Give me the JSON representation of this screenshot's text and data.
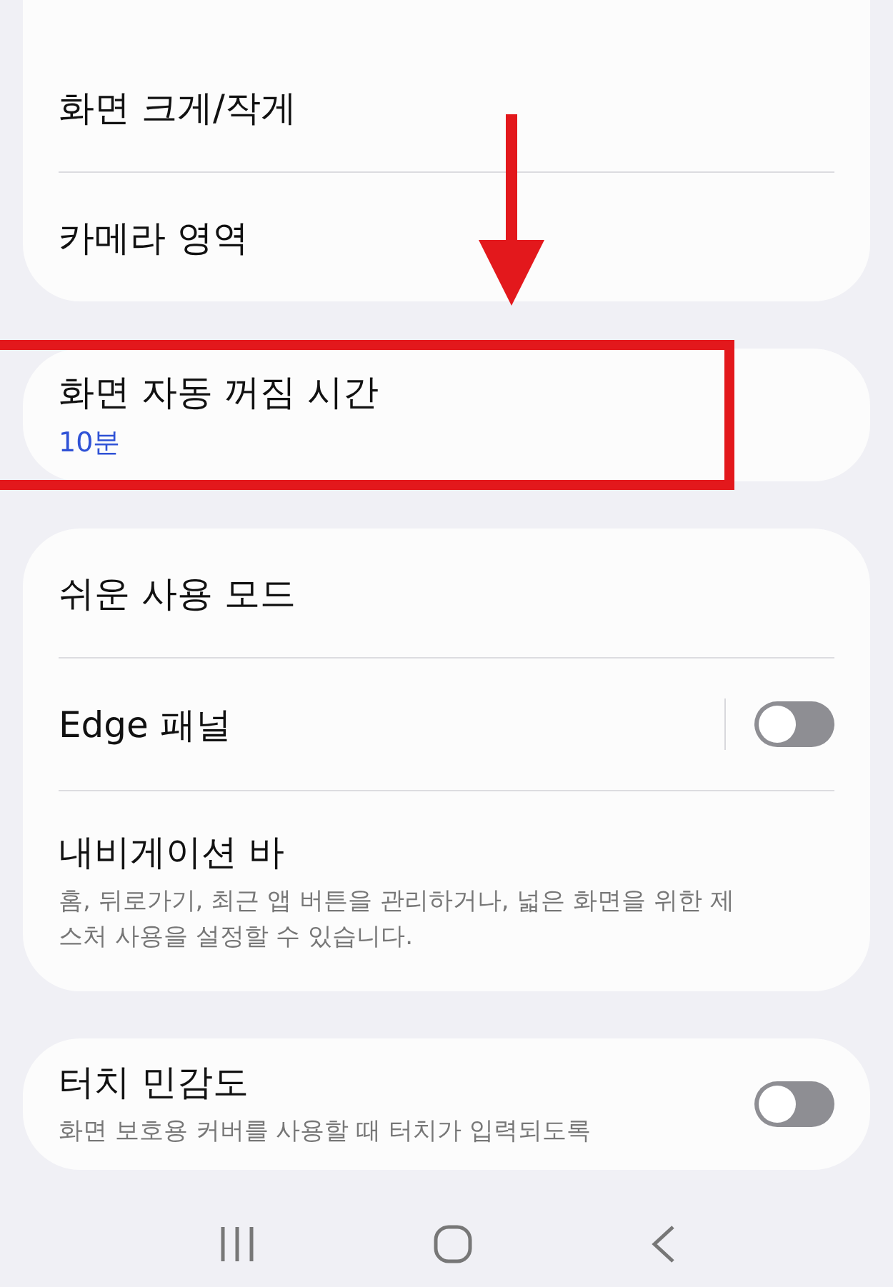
{
  "sections": [
    {
      "cut_top": true,
      "items": [
        {
          "kind": "plain",
          "title": "화면 크게/작게",
          "highlighted": false
        },
        {
          "kind": "plain",
          "title": "카메라 영역",
          "highlighted": false
        }
      ]
    },
    {
      "cut_top": false,
      "items": [
        {
          "kind": "value",
          "title": "화면 자동 꺼짐 시간",
          "value": "10분",
          "highlighted": true
        }
      ]
    },
    {
      "cut_top": false,
      "items": [
        {
          "kind": "plain",
          "title": "쉬운 사용 모드",
          "highlighted": false
        },
        {
          "kind": "toggle",
          "title": "Edge 패널",
          "on": false,
          "highlighted": false
        },
        {
          "kind": "description",
          "title": "내비게이션 바",
          "description": "홈, 뒤로가기, 최근 앱 버튼을 관리하거나, 넓은 화면을 위한 제스처 사용을 설정할 수 있습니다.",
          "highlighted": false
        }
      ]
    },
    {
      "cut_top": false,
      "items": [
        {
          "kind": "toggle_description",
          "title": "터치 민감도",
          "description": "화면 보호용 커버를 사용할 때 터치가 입력되도록",
          "on": false,
          "highlighted": false
        }
      ]
    }
  ]
}
